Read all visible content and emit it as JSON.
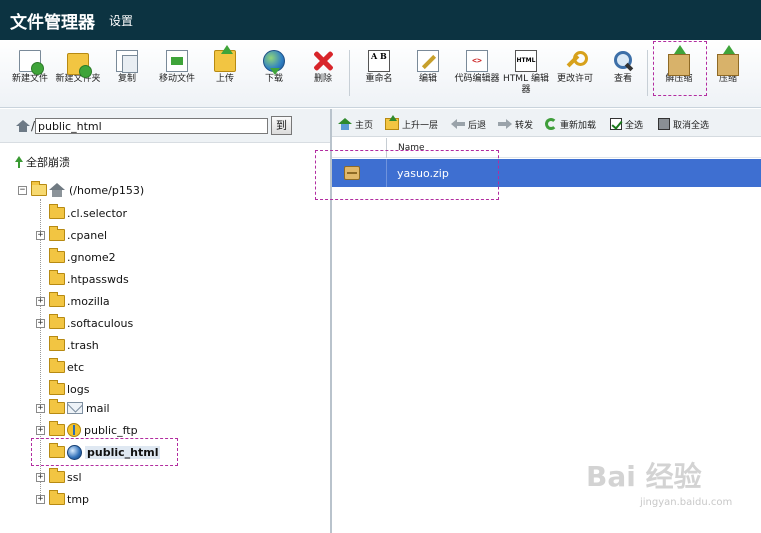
{
  "header": {
    "title": "文件管理器",
    "settings_label": "设置"
  },
  "toolbar": {
    "buttons": [
      {
        "id": "new-file",
        "icon": "new-file-icon",
        "label": "新建文件"
      },
      {
        "id": "new-folder",
        "icon": "new-folder-icon",
        "label": "新建文件夹"
      },
      {
        "id": "copy",
        "icon": "copy-icon",
        "label": "复制"
      },
      {
        "id": "move-file",
        "icon": "move-file-icon",
        "label": "移动文件"
      },
      {
        "id": "upload",
        "icon": "upload-icon",
        "label": "上传"
      },
      {
        "id": "download",
        "icon": "download-icon",
        "label": "下载"
      },
      {
        "id": "delete",
        "icon": "delete-icon",
        "label": "删除"
      },
      {
        "id": "rename",
        "icon": "rename-icon",
        "label": "重命名"
      },
      {
        "id": "edit",
        "icon": "edit-icon",
        "label": "编辑"
      },
      {
        "id": "code-editor",
        "icon": "code-editor-icon",
        "label": "代码编辑器"
      },
      {
        "id": "html-editor",
        "icon": "html-editor-icon",
        "label": "HTML 编辑器"
      },
      {
        "id": "change-permissions",
        "icon": "key-icon",
        "label": "更改许可"
      },
      {
        "id": "view",
        "icon": "magnifier-icon",
        "label": "查看"
      },
      {
        "id": "extract",
        "icon": "extract-box-icon",
        "label": "解压缩"
      },
      {
        "id": "compress",
        "icon": "compress-box-icon",
        "label": "压缩"
      }
    ],
    "rename_icon_text": "A B",
    "code_icon_text": "<>",
    "html_icon_text": "HTML"
  },
  "left": {
    "path_value": "public_html",
    "go_label": "到",
    "collapse_label": "全部崩溃",
    "root_label": "(/home/p153)",
    "tree": [
      {
        "label": ".cl.selector",
        "expandable": false
      },
      {
        "label": ".cpanel",
        "expandable": true
      },
      {
        "label": ".gnome2",
        "expandable": false
      },
      {
        "label": ".htpasswds",
        "expandable": false
      },
      {
        "label": ".mozilla",
        "expandable": true
      },
      {
        "label": ".softaculous",
        "expandable": true
      },
      {
        "label": ".trash",
        "expandable": false
      },
      {
        "label": "etc",
        "expandable": false
      },
      {
        "label": "logs",
        "expandable": false
      },
      {
        "label": "mail",
        "expandable": true,
        "icon": "mail-icon"
      },
      {
        "label": "public_ftp",
        "expandable": true,
        "icon": "ftp-icon"
      },
      {
        "label": "public_html",
        "expandable": false,
        "icon": "web-globe-icon",
        "selected": true
      },
      {
        "label": "ssl",
        "expandable": true
      },
      {
        "label": "tmp",
        "expandable": true
      }
    ]
  },
  "right": {
    "nav": {
      "home": "主页",
      "up": "上升一层",
      "back": "后退",
      "forward": "转发",
      "reload": "重新加载",
      "select_all": "全选",
      "deselect_all": "取消全选"
    },
    "column_name": "Name",
    "files": [
      {
        "name": "yasuo.zip",
        "icon": "zip-archive-icon",
        "selected": true
      }
    ]
  },
  "watermark": {
    "brand": "Bai 经验",
    "url": "jingyan.baidu.com"
  },
  "colors": {
    "header_bg": "#0c3341",
    "selection": "#3e6fd1",
    "highlight_box": "#b22ca0"
  }
}
